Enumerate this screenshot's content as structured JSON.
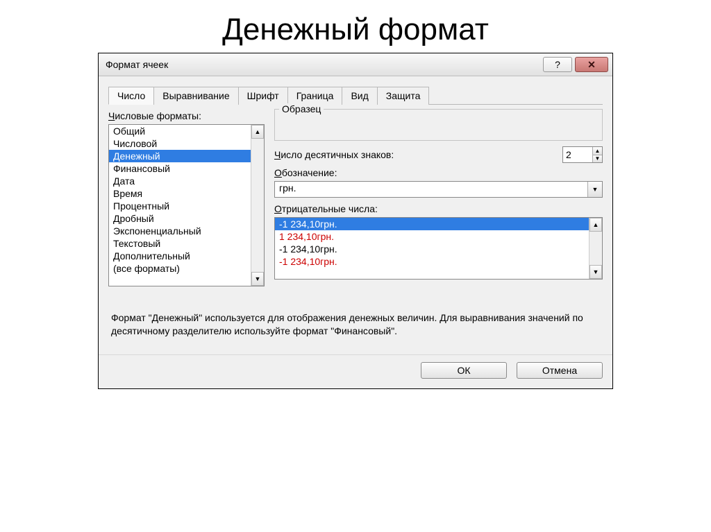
{
  "page_heading": "Денежный формат",
  "dialog": {
    "title": "Формат ячеек",
    "tabs": [
      "Число",
      "Выравнивание",
      "Шрифт",
      "Граница",
      "Вид",
      "Защита"
    ],
    "active_tab": 0,
    "formats_label": "Числовые форматы:",
    "formats": [
      "Общий",
      "Числовой",
      "Денежный",
      "Финансовый",
      "Дата",
      "Время",
      "Процентный",
      "Дробный",
      "Экспоненциальный",
      "Текстовый",
      "Дополнительный",
      "(все форматы)"
    ],
    "formats_selected_index": 2,
    "sample_label": "Образец",
    "decimals_label": "Число десятичных знаков:",
    "decimals_value": "2",
    "symbol_label": "Обозначение:",
    "symbol_value": "грн.",
    "negative_label": "Отрицательные числа:",
    "negatives": [
      {
        "text": "-1 234,10грн.",
        "red": false,
        "selected": true
      },
      {
        "text": "1 234,10грн.",
        "red": true,
        "selected": false
      },
      {
        "text": "-1 234,10грн.",
        "red": false,
        "selected": false
      },
      {
        "text": "-1 234,10грн.",
        "red": true,
        "selected": false
      }
    ],
    "description": "Формат \"Денежный\" используется для отображения денежных величин. Для выравнивания значений по десятичному разделителю используйте формат \"Финансовый\".",
    "ok": "ОК",
    "cancel": "Отмена"
  }
}
